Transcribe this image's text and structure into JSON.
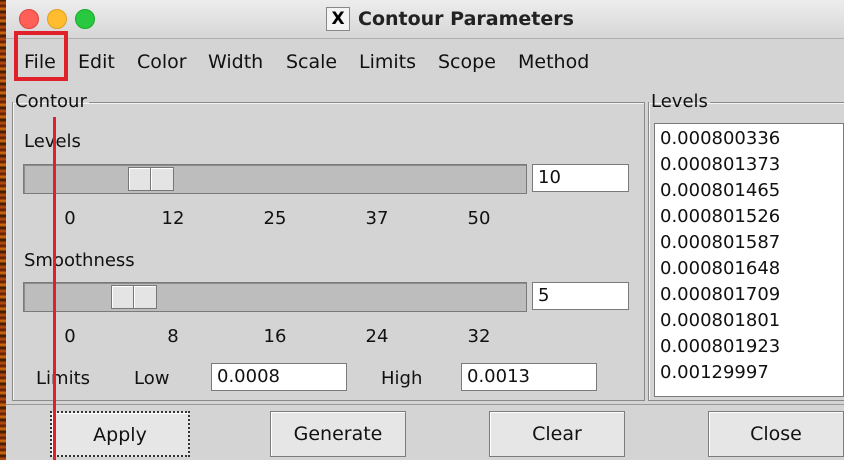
{
  "window": {
    "title": "Contour Parameters"
  },
  "menu": [
    "File",
    "Edit",
    "Color",
    "Width",
    "Scale",
    "Limits",
    "Scope",
    "Method"
  ],
  "contour": {
    "group_label": "Contour",
    "levels": {
      "label": "Levels",
      "value": "10",
      "ticks": [
        "0",
        "12",
        "25",
        "37",
        "50"
      ],
      "slider_value": 10,
      "slider_max": 50
    },
    "smoothness": {
      "label": "Smoothness",
      "value": "5",
      "ticks": [
        "0",
        "8",
        "16",
        "24",
        "32"
      ],
      "slider_value": 5,
      "slider_max": 32
    },
    "limits": {
      "label": "Limits",
      "low_label": "Low",
      "low_value": "0.0008",
      "high_label": "High",
      "high_value": "0.0013"
    }
  },
  "levels_panel": {
    "group_label": "Levels",
    "items": [
      "0.000800336",
      "0.000801373",
      "0.000801465",
      "0.000801526",
      "0.000801587",
      "0.000801648",
      "0.000801709",
      "0.000801801",
      "0.000801923",
      "0.00129997"
    ]
  },
  "buttons": {
    "apply": "Apply",
    "generate": "Generate",
    "clear": "Clear",
    "close": "Close"
  },
  "annotation_color": "#e0202a"
}
